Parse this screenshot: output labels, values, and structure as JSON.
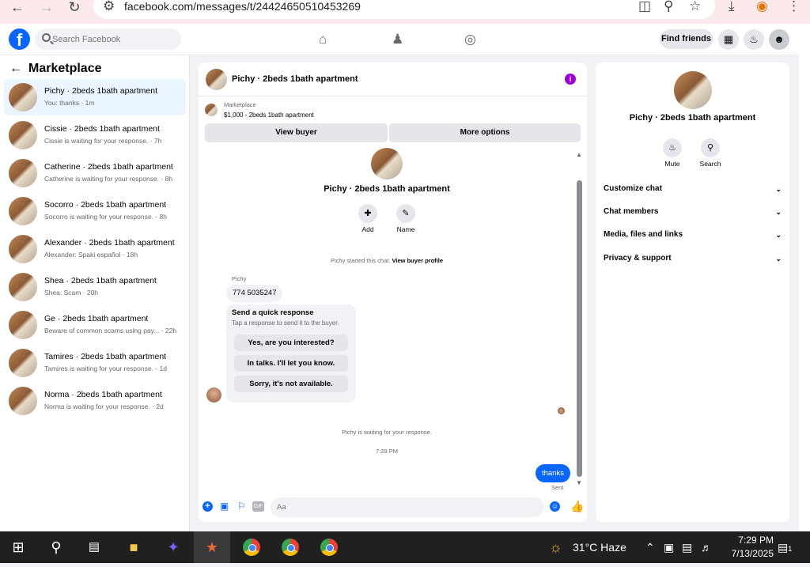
{
  "browser": {
    "url": "facebook.com/messages/t/24424650510453269"
  },
  "fb": {
    "logo": "f",
    "search_placeholder": "Search Facebook",
    "find_friends": "Find friends"
  },
  "left": {
    "title": "Marketplace",
    "conversations": [
      {
        "title": "Pichy · 2beds 1bath apartment",
        "snippet": "You: thanks · 1m",
        "active": true
      },
      {
        "title": "Cissie · 2beds 1bath apartment",
        "snippet": "Cissie is waiting for your response. · 7h"
      },
      {
        "title": "Catherine · 2beds 1bath apartment",
        "snippet": "Catherine is waiting for your response. · 8h"
      },
      {
        "title": "Socorro · 2beds 1bath apartment",
        "snippet": "Socorro is waiting for your response. · 8h"
      },
      {
        "title": "Alexander · 2beds 1bath apartment",
        "snippet": "Alexander: Spaki español · 18h"
      },
      {
        "title": "Shea · 2beds 1bath apartment",
        "snippet": "Shea: Scam · 20h"
      },
      {
        "title": "Ge · 2beds 1bath apartment",
        "snippet": "Beware of common scams using pay... · 22h"
      },
      {
        "title": "Tamires · 2beds 1bath apartment",
        "snippet": "Tamires is waiting for your response. · 1d"
      },
      {
        "title": "Norma · 2beds 1bath apartment",
        "snippet": "Norma is waiting for your response. · 2d"
      }
    ]
  },
  "chat": {
    "header_title": "Pichy · 2beds 1bath apartment",
    "marketplace_label": "Marketplace",
    "listing": "$1,000 - 2beds 1bath apartment",
    "view_buyer": "View buyer",
    "more_options": "More options",
    "profile_name": "Pichy · 2beds 1bath apartment",
    "add_label": "Add",
    "name_label": "Name",
    "started_text": "Pichy started this chat.",
    "view_buyer_profile": "View buyer profile",
    "sender_name": "Pichy",
    "message1": "774 5035247",
    "quick_title": "Send a quick response",
    "quick_sub": "Tap a response to send it to the buyer.",
    "quick_options": [
      "Yes, are you interested?",
      "In talks. I'll let you know.",
      "Sorry, it's not available."
    ],
    "waiting_text": "Pichy is waiting for your response.",
    "time": "7:29 PM",
    "my_message": "thanks",
    "sent_label": "Sent",
    "composer_placeholder": "Aa",
    "gif_label": "GIF"
  },
  "right": {
    "name": "Pichy · 2beds 1bath apartment",
    "mute": "Mute",
    "search": "Search",
    "items": [
      "Customize chat",
      "Chat members",
      "Media, files and links",
      "Privacy & support"
    ]
  },
  "taskbar": {
    "weather": "31°C  Haze",
    "time": "7:29 PM",
    "date": "7/13/2025",
    "notif_count": "1"
  }
}
